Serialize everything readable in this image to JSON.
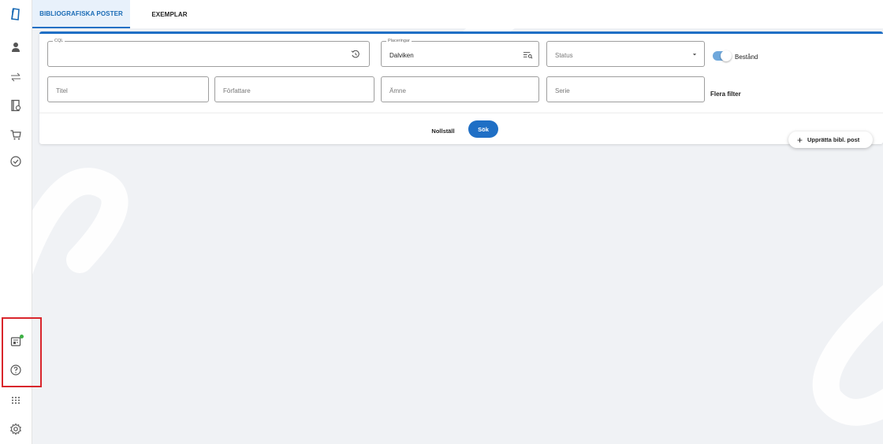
{
  "tabs": {
    "bibliographic": "BIBLIOGRAFISKA POSTER",
    "items": "EXEMPLAR"
  },
  "search": {
    "cql_legend": "CQL",
    "placement_legend": "Placeringar",
    "placement_value": "Dalviken",
    "status_placeholder": "Status",
    "holdings_label": "Bestånd",
    "title_placeholder": "Titel",
    "author_placeholder": "Författare",
    "subject_placeholder": "Ämne",
    "series_placeholder": "Serie",
    "more_filters": "Flera filter",
    "reset_label": "Nollställ",
    "search_label": "Sök",
    "holdings_toggle_on": true
  },
  "create_button": {
    "label": "Upprätta bibl. post",
    "icon": "+"
  },
  "sidebar_icons": [
    "catalog-icon",
    "patrons-icon",
    "circulation-icon",
    "serials-icon",
    "acquisitions-icon",
    "tasks-icon",
    "news-icon",
    "help-icon",
    "apps-icon",
    "settings-icon"
  ],
  "colors": {
    "accent": "#1f6fc5",
    "toggle": "#6fa8dc",
    "notification": "#3cb043",
    "highlight_box": "#d9262c"
  }
}
